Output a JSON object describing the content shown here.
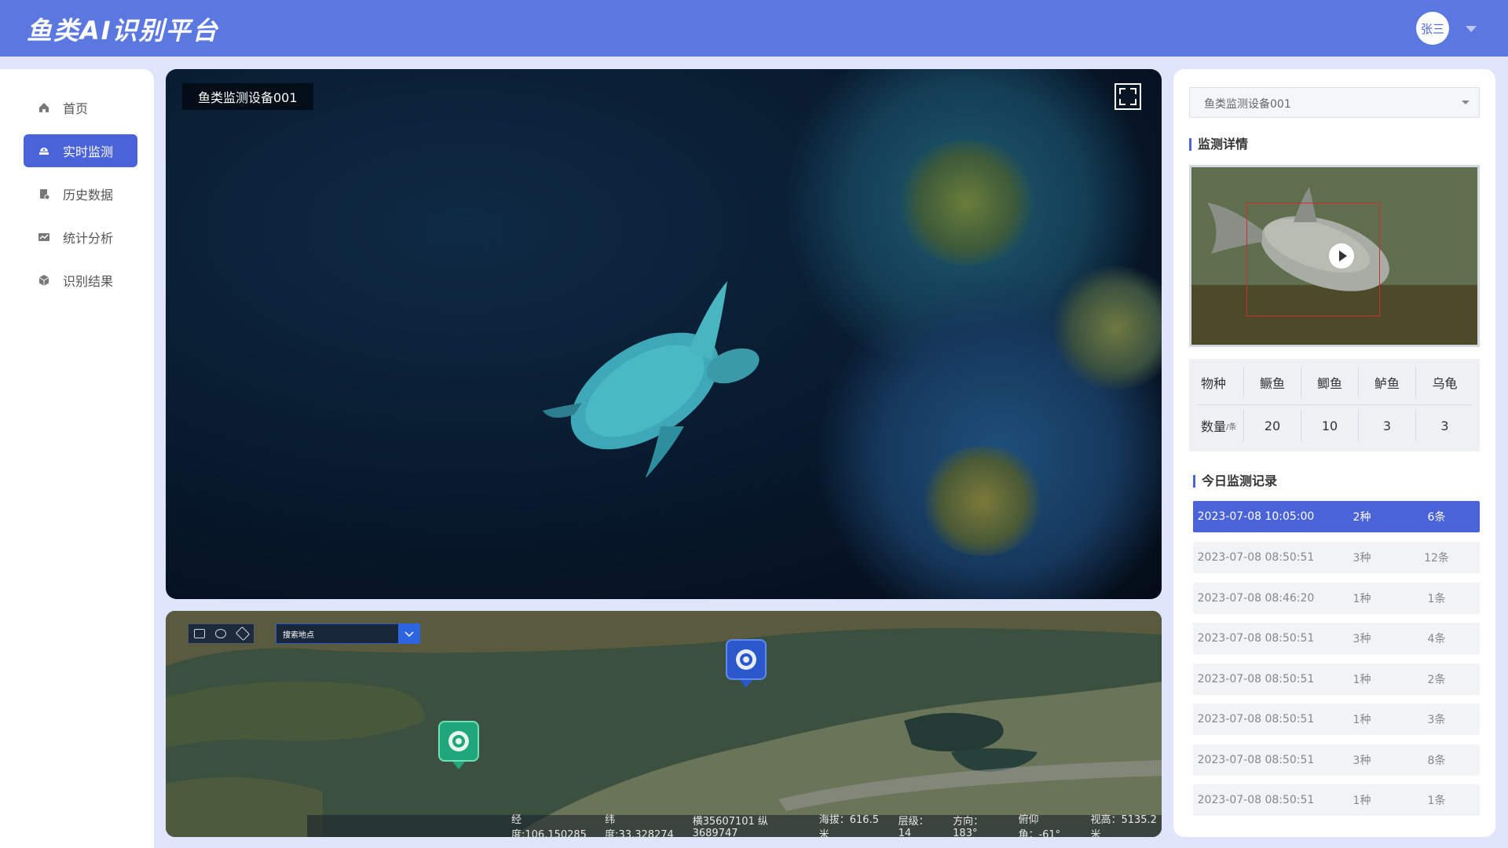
{
  "header": {
    "title": "鱼类AI识别平台",
    "user_name": "张三"
  },
  "sidebar": {
    "items": [
      {
        "label": "首页",
        "icon": "home-icon",
        "active": false
      },
      {
        "label": "实时监测",
        "icon": "monitor-icon",
        "active": true
      },
      {
        "label": "历史数据",
        "icon": "history-icon",
        "active": false
      },
      {
        "label": "统计分析",
        "icon": "chart-icon",
        "active": false
      },
      {
        "label": "识别结果",
        "icon": "cube-icon",
        "active": false
      }
    ]
  },
  "video": {
    "device_label": "鱼类监测设备001",
    "fullscreen_icon": "fullscreen-icon"
  },
  "map": {
    "search_placeholder": "搜索地点",
    "tools": [
      "image-icon",
      "layers-icon",
      "draw-icon"
    ],
    "markers": [
      {
        "type": "device",
        "color": "#2a57c9"
      },
      {
        "type": "device",
        "color": "#1fa67a"
      }
    ],
    "status": {
      "lng": "经度:106.150285",
      "lat": "纬度:33.328274",
      "proj": "横35607101 纵3689747",
      "altitude": "海拔：616.5米",
      "level": "层级：14",
      "direction": "方向：183°",
      "pitch": "俯仰角：-61°",
      "view_height": "视高：5135.2米"
    }
  },
  "right_panel": {
    "device_select": "鱼类监测设备001",
    "detail_title": "监测详情",
    "species_table": {
      "row1_label": "物种",
      "row2_label": "数量",
      "unit": "/条",
      "species": [
        "鳜鱼",
        "鲫鱼",
        "鲈鱼",
        "乌龟"
      ],
      "counts": [
        "20",
        "10",
        "3",
        "3"
      ]
    },
    "records_title": "今日监测记录",
    "records": [
      {
        "time": "2023-07-08  10:05:00",
        "kinds": "2种",
        "count": "6条",
        "active": true
      },
      {
        "time": "2023-07-08 08:50:51",
        "kinds": "3种",
        "count": "12条",
        "active": false
      },
      {
        "time": "2023-07-08 08:46:20",
        "kinds": "1种",
        "count": "1条",
        "active": false
      },
      {
        "time": "2023-07-08 08:50:51",
        "kinds": "3种",
        "count": "4条",
        "active": false
      },
      {
        "time": "2023-07-08 08:50:51",
        "kinds": "1种",
        "count": "2条",
        "active": false
      },
      {
        "time": "2023-07-08 08:50:51",
        "kinds": "1种",
        "count": "3条",
        "active": false
      },
      {
        "time": "2023-07-08 08:50:51",
        "kinds": "3种",
        "count": "8条",
        "active": false
      },
      {
        "time": "2023-07-08 08:50:51",
        "kinds": "1种",
        "count": "1条",
        "active": false
      }
    ]
  },
  "colors": {
    "brand": "#5b78e1",
    "accent": "#4a63d8"
  }
}
